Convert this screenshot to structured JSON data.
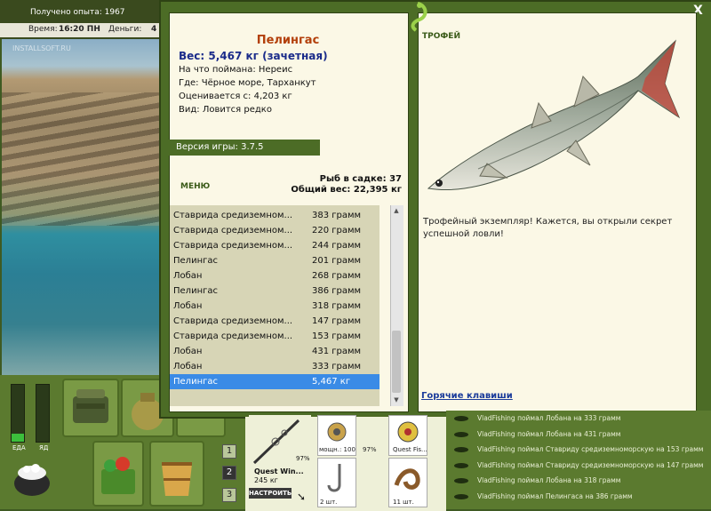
{
  "hud": {
    "exp_label": "Получено опыта:",
    "exp_value": "1967",
    "time_label": "Время:",
    "time_value": "16:20 ПН",
    "money_label": "Деньги:",
    "money_value": "4"
  },
  "scene": {
    "watermark": "INSTALLSOFT.RU"
  },
  "gauges": {
    "food_label": "ЕДА",
    "poison_label": "ЯД",
    "food_level": 0.14,
    "poison_level": 0.0
  },
  "slots": [
    "1",
    "2",
    "3"
  ],
  "dialog": {
    "close": "X",
    "fish_name": "Пелингас",
    "weight": "Вес: 5,467 кг (зачетная)",
    "caught_on": "На что поймана: Нереис",
    "location": "Где: Чёрное море, Тарханкут",
    "valued_from": "Оценивается с: 4,203 кг",
    "species": "Вид: Ловится редко",
    "version": "Версия игры: 3.7.5",
    "menu": "МЕНЮ",
    "keepnet_count": "Рыб в садке: 37",
    "keepnet_weight": "Общий вес: 22,395 кг",
    "trophy_title": "ТРОФЕЙ",
    "trophy_text": "Трофейный экземпляр! Кажется, вы открыли секрет успешной ловли!",
    "hotkeys": "Горячие клавиши"
  },
  "catch_list": [
    {
      "name": "Ставрида средиземном...",
      "weight": "383 грамм"
    },
    {
      "name": "Ставрида средиземном...",
      "weight": "220 грамм"
    },
    {
      "name": "Ставрида средиземном...",
      "weight": "244 грамм"
    },
    {
      "name": "Пелингас",
      "weight": "201 грамм"
    },
    {
      "name": "Лобан",
      "weight": "268 грамм"
    },
    {
      "name": "Пелингас",
      "weight": "386 грамм"
    },
    {
      "name": "Лобан",
      "weight": "318 грамм"
    },
    {
      "name": "Ставрида средиземном...",
      "weight": "147 грамм"
    },
    {
      "name": "Ставрида средиземном...",
      "weight": "153 грамм"
    },
    {
      "name": "Лобан",
      "weight": "431 грамм"
    },
    {
      "name": "Лобан",
      "weight": "333 грамм"
    },
    {
      "name": "Пелингас",
      "weight": "5,467 кг",
      "selected": true
    }
  ],
  "tackle": {
    "rod_name": "Quest Win...",
    "rod_weight": "245 кг",
    "rod_pct": "97%",
    "reel_label": "мощн.: 100",
    "reel_pct": "97%",
    "line_label": "Quest Fis...",
    "hook_count": "2 шт.",
    "bait_count": "11 шт.",
    "setup_button": "НАСТРОИТЬ"
  },
  "log": [
    "VladFishing поймал Лобана на 333 грамм",
    "VladFishing поймал Лобана на 431 грамм",
    "VladFishing поймал Ставриду средиземноморскую на 153 грамм",
    "VladFishing поймал Ставриду средиземноморскую на 147 грамм",
    "VladFishing поймал Лобана на 318 грамм",
    "VladFishing поймал Пелингаса на 386 грамм"
  ]
}
